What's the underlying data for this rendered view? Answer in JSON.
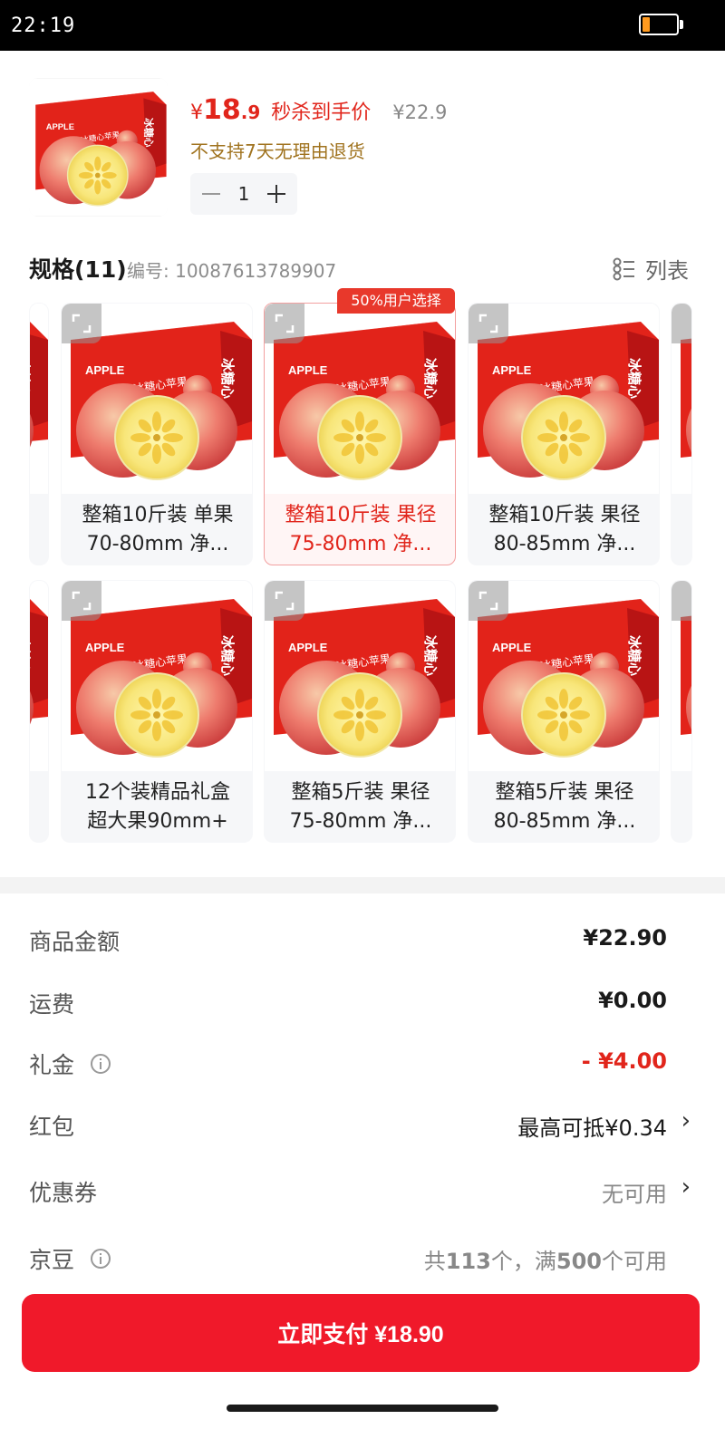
{
  "status_bar": {
    "time": "22:19"
  },
  "product": {
    "price_symbol": "¥",
    "price_int": "18",
    "price_dec": ".9",
    "price_label": "秒杀到手价",
    "original_price": "¥22.9",
    "return_policy": "不支持7天无理由退货",
    "quantity": "1"
  },
  "specs": {
    "title": "规格(11)",
    "code": "编号: 10087613789907",
    "list_label": "列表",
    "popular_tag": "50%用户选择",
    "items": [
      {
        "line1": "整箱10斤装 单果",
        "line2": "70-80mm 净..."
      },
      {
        "line1": "整箱10斤装 果径",
        "line2": "75-80mm 净..."
      },
      {
        "line1": "整箱10斤装 果径",
        "line2": "80-85mm 净..."
      },
      {
        "line1": "12个装精品礼盒",
        "line2": "超大果90mm+"
      },
      {
        "line1": "整箱5斤装 果径",
        "line2": "75-80mm 净..."
      },
      {
        "line1": "整箱5斤装 果径",
        "line2": "80-85mm 净..."
      }
    ],
    "box_text": {
      "brand": "APPLE",
      "name": "冰糖心苹果",
      "side": "冰糖心"
    }
  },
  "fees": {
    "goods_label": "商品金额",
    "goods_value": "¥22.90",
    "shipping_label": "运费",
    "shipping_value": "¥0.00",
    "gift_label": "礼金",
    "gift_value": "- ¥4.00",
    "redpacket_label": "红包",
    "redpacket_value": "最高可抵¥0.34",
    "coupon_label": "优惠券",
    "coupon_value": "无可用",
    "jingdou_label": "京豆",
    "jingdou_value_a": "共",
    "jingdou_value_b": "113",
    "jingdou_value_c": "个，满",
    "jingdou_value_d": "500",
    "jingdou_value_e": "个可用"
  },
  "pay": {
    "label": "立即支付 ¥18.90"
  },
  "colors": {
    "accent": "#e1251b",
    "pay": "#f0192a",
    "gold": "#a0731f"
  },
  "icons": [
    "battery-icon",
    "minus-icon",
    "plus-icon",
    "list-icon",
    "expand-icon",
    "info-icon",
    "chevron-right-icon"
  ]
}
